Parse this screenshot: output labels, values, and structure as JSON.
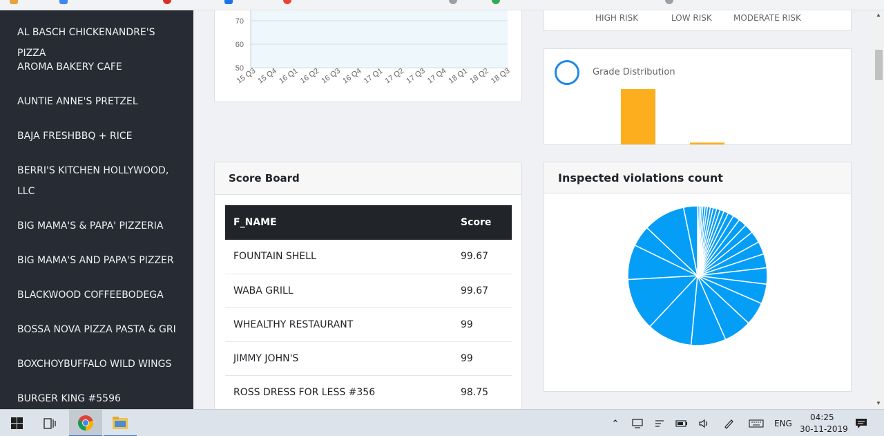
{
  "sidebar": {
    "items": [
      {
        "label": "AL BASCH CHICKENANDRE'S PIZZA"
      },
      {
        "label": "AROMA BAKERY CAFE"
      },
      {
        "label": "AUNTIE ANNE'S PRETZEL"
      },
      {
        "label": "BAJA FRESHBBQ + RICE"
      },
      {
        "label": "BERRI'S KITCHEN HOLLYWOOD,",
        "label2": "LLC"
      },
      {
        "label": "BIG MAMA'S & PAPA' PIZZERIA"
      },
      {
        "label": "BIG MAMA'S AND PAPA'S PIZZER"
      },
      {
        "label": "BLACKWOOD COFFEEBODEGA"
      },
      {
        "label": "BOSSA NOVA PIZZA PASTA & GRI"
      },
      {
        "label": "BOXCHOYBUFFALO WILD WINGS"
      },
      {
        "label": "BURGER KING #5596"
      }
    ]
  },
  "risk_legend": [
    "HIGH RISK",
    "LOW RISK",
    "MODERATE RISK"
  ],
  "chart_data": [
    {
      "type": "area",
      "title": "",
      "categories": [
        "15 Q3",
        "15 Q4",
        "16 Q1",
        "16 Q2",
        "16 Q3",
        "16 Q4",
        "17 Q1",
        "17 Q2",
        "17 Q3",
        "17 Q4",
        "18 Q1",
        "18 Q2",
        "18 Q3"
      ],
      "y_ticks_visible": [
        "70",
        "60",
        "50"
      ],
      "ylim": [
        50,
        70
      ],
      "grid": true
    },
    {
      "type": "bar",
      "title": "Grade Distribution",
      "series_color": "#fcae1e",
      "values_relative": [
        1.0,
        0.09,
        0.01
      ]
    },
    {
      "type": "pie",
      "title": "Inspected violations count",
      "color": "#049ef7",
      "slice_degrees": [
        1.5,
        1.5,
        1.5,
        2,
        2,
        2.5,
        2.5,
        3,
        3,
        3.5,
        4,
        5,
        6,
        7,
        8,
        10,
        11,
        12,
        14,
        17,
        20,
        24,
        30,
        39,
        45,
        30,
        18,
        36,
        12
      ]
    }
  ],
  "grade_card": {
    "title": "Grade Distribution"
  },
  "score_board": {
    "title": "Score Board",
    "columns": [
      "F_NAME",
      "Score"
    ],
    "rows": [
      [
        "FOUNTAIN SHELL",
        "99.67"
      ],
      [
        "WABA GRILL",
        "99.67"
      ],
      [
        "WHEALTHY RESTAURANT",
        "99"
      ],
      [
        "JIMMY JOHN'S",
        "99"
      ],
      [
        "ROSS DRESS FOR LESS #356",
        "98.75"
      ]
    ]
  },
  "violations_card": {
    "title": "Inspected violations count"
  },
  "taskbar": {
    "language": "ENG",
    "time": "04:25",
    "date": "30-11-2019"
  },
  "colors": {
    "sidebar_bg": "#272b33",
    "accent_blue": "#049ef7",
    "bar_orange": "#fcae1e",
    "ring_blue": "#1e88e5"
  }
}
